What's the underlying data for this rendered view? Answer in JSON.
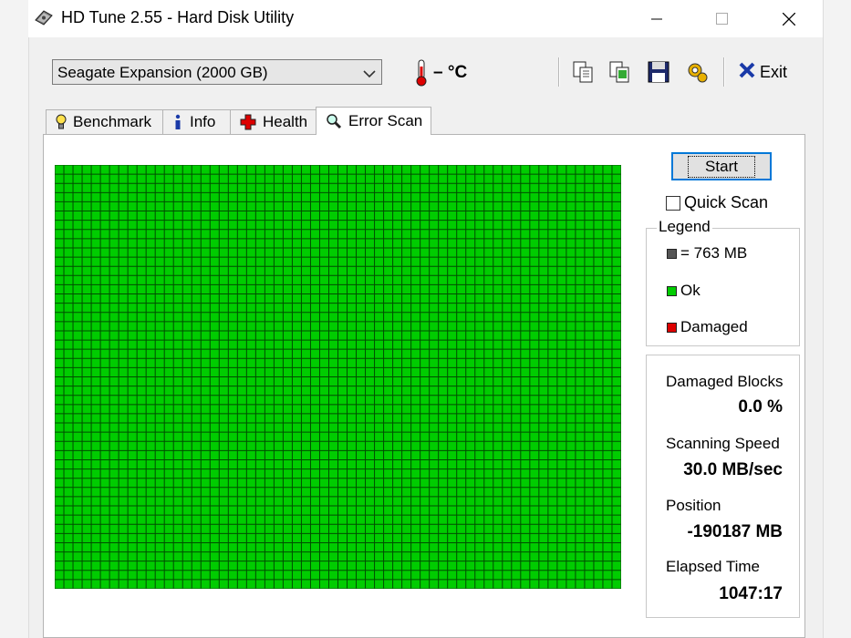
{
  "window": {
    "title": "HD Tune 2.55 - Hard Disk Utility",
    "icon": "hdd-app-icon"
  },
  "toolbar": {
    "drive": "Seagate Expansion (2000 GB)",
    "temperature": "– °C",
    "exit_label": "Exit"
  },
  "tabs": [
    {
      "label": "Benchmark",
      "icon": "lightbulb-icon"
    },
    {
      "label": "Info",
      "icon": "info-icon"
    },
    {
      "label": "Health",
      "icon": "health-cross-icon"
    },
    {
      "label": "Error Scan",
      "icon": "magnifier-icon",
      "active": true
    }
  ],
  "scan": {
    "start_label": "Start",
    "quick_scan_label": "Quick Scan",
    "quick_scan_checked": false,
    "block_color_ok": "#00cc00",
    "grid_line_color": "#004d00"
  },
  "legend": {
    "title": "Legend",
    "block_size": "= 763 MB",
    "ok": "Ok",
    "damaged": "Damaged",
    "colors": {
      "block": "#555555",
      "ok": "#00cc00",
      "damaged": "#dd0000"
    }
  },
  "stats": {
    "damaged_blocks_label": "Damaged Blocks",
    "damaged_blocks_value": "0.0 %",
    "scanning_speed_label": "Scanning Speed",
    "scanning_speed_value": "30.0 MB/sec",
    "position_label": "Position",
    "position_value": "-190187 MB",
    "elapsed_time_label": "Elapsed Time",
    "elapsed_time_value": "1047:17"
  }
}
